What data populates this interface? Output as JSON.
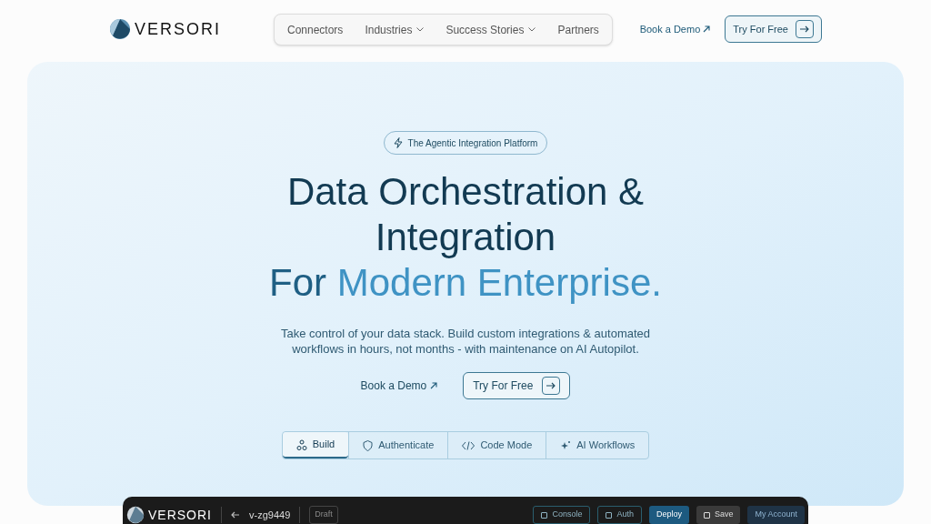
{
  "header": {
    "logo": "VERSORI",
    "nav": [
      {
        "label": "Connectors",
        "dropdown": false
      },
      {
        "label": "Industries",
        "dropdown": true
      },
      {
        "label": "Success Stories",
        "dropdown": true
      },
      {
        "label": "Partners",
        "dropdown": false
      }
    ],
    "book_demo": "Book a Demo",
    "try_free": "Try For Free"
  },
  "hero": {
    "badge": "The Agentic Integration Platform",
    "headline": "Data Orchestration & Integration",
    "headline_lead": "For",
    "headline_accent": "Modern Enterprise.",
    "subtitle": "Take control of your data stack. Build custom integrations & automated workflows in hours, not months - with maintenance on AI Autopilot.",
    "book_demo": "Book a Demo",
    "try_free": "Try For Free",
    "tabs": [
      {
        "label": "Build",
        "kind": "build",
        "selected": true
      },
      {
        "label": "Authenticate",
        "kind": "shield",
        "selected": false
      },
      {
        "label": "Code Mode",
        "kind": "code",
        "selected": false
      },
      {
        "label": "AI Workflows",
        "kind": "sparkle",
        "selected": false
      }
    ]
  },
  "app_preview": {
    "logo": "VERSORI",
    "project": "v-zg9449",
    "status": "Draft",
    "buttons": [
      {
        "label": "Console",
        "kind": "outline"
      },
      {
        "label": "Auth",
        "kind": "outline"
      },
      {
        "label": "Deploy",
        "kind": "primary"
      },
      {
        "label": "Save",
        "kind": "grey"
      },
      {
        "label": "My Account",
        "kind": "account"
      }
    ]
  }
}
